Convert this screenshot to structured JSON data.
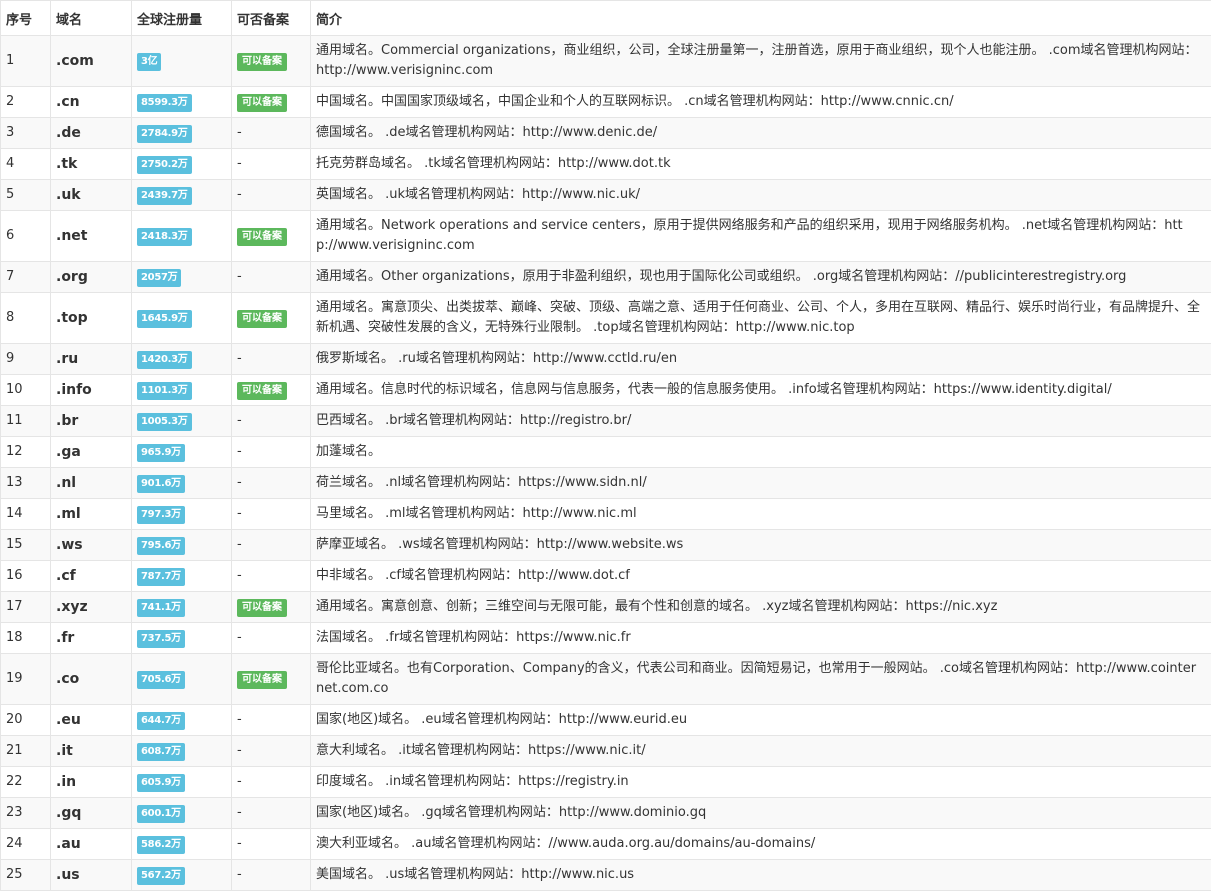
{
  "headers": {
    "idx": "序号",
    "domain": "域名",
    "reg": "全球注册量",
    "icp": "可否备案",
    "desc": "简介"
  },
  "rows": [
    {
      "idx": "1",
      "domain": ".com",
      "reg": "3亿",
      "icp": "可以备案",
      "desc": "通用域名。Commercial organizations，商业组织，公司，全球注册量第一，注册首选，原用于商业组织，现个人也能注册。 .com域名管理机构网站：http://www.verisigninc.com"
    },
    {
      "idx": "2",
      "domain": ".cn",
      "reg": "8599.3万",
      "icp": "可以备案",
      "desc": "中国域名。中国国家顶级域名，中国企业和个人的互联网标识。 .cn域名管理机构网站：http://www.cnnic.cn/"
    },
    {
      "idx": "3",
      "domain": ".de",
      "reg": "2784.9万",
      "icp": "-",
      "desc": "德国域名。 .de域名管理机构网站：http://www.denic.de/"
    },
    {
      "idx": "4",
      "domain": ".tk",
      "reg": "2750.2万",
      "icp": "-",
      "desc": "托克劳群岛域名。 .tk域名管理机构网站：http://www.dot.tk"
    },
    {
      "idx": "5",
      "domain": ".uk",
      "reg": "2439.7万",
      "icp": "-",
      "desc": "英国域名。 .uk域名管理机构网站：http://www.nic.uk/"
    },
    {
      "idx": "6",
      "domain": ".net",
      "reg": "2418.3万",
      "icp": "可以备案",
      "desc": "通用域名。Network operations and service centers，原用于提供网络服务和产品的组织采用，现用于网络服务机构。 .net域名管理机构网站：http://www.verisigninc.com"
    },
    {
      "idx": "7",
      "domain": ".org",
      "reg": "2057万",
      "icp": "-",
      "desc": "通用域名。Other organizations，原用于非盈利组织，现也用于国际化公司或组织。 .org域名管理机构网站：//publicinterestregistry.org"
    },
    {
      "idx": "8",
      "domain": ".top",
      "reg": "1645.9万",
      "icp": "可以备案",
      "desc": "通用域名。寓意顶尖、出类拔萃、巅峰、突破、顶级、高端之意、适用于任何商业、公司、个人，多用在互联网、精品行、娱乐时尚行业，有品牌提升、全新机遇、突破性发展的含义，无特殊行业限制。 .top域名管理机构网站：http://www.nic.top"
    },
    {
      "idx": "9",
      "domain": ".ru",
      "reg": "1420.3万",
      "icp": "-",
      "desc": "俄罗斯域名。 .ru域名管理机构网站：http://www.cctld.ru/en"
    },
    {
      "idx": "10",
      "domain": ".info",
      "reg": "1101.3万",
      "icp": "可以备案",
      "desc": "通用域名。信息时代的标识域名，信息网与信息服务，代表一般的信息服务使用。 .info域名管理机构网站：https://www.identity.digital/"
    },
    {
      "idx": "11",
      "domain": ".br",
      "reg": "1005.3万",
      "icp": "-",
      "desc": "巴西域名。 .br域名管理机构网站：http://registro.br/"
    },
    {
      "idx": "12",
      "domain": ".ga",
      "reg": "965.9万",
      "icp": "-",
      "desc": "加蓬域名。"
    },
    {
      "idx": "13",
      "domain": ".nl",
      "reg": "901.6万",
      "icp": "-",
      "desc": "荷兰域名。 .nl域名管理机构网站：https://www.sidn.nl/"
    },
    {
      "idx": "14",
      "domain": ".ml",
      "reg": "797.3万",
      "icp": "-",
      "desc": "马里域名。 .ml域名管理机构网站：http://www.nic.ml"
    },
    {
      "idx": "15",
      "domain": ".ws",
      "reg": "795.6万",
      "icp": "-",
      "desc": "萨摩亚域名。 .ws域名管理机构网站：http://www.website.ws"
    },
    {
      "idx": "16",
      "domain": ".cf",
      "reg": "787.7万",
      "icp": "-",
      "desc": "中非域名。 .cf域名管理机构网站：http://www.dot.cf"
    },
    {
      "idx": "17",
      "domain": ".xyz",
      "reg": "741.1万",
      "icp": "可以备案",
      "desc": "通用域名。寓意创意、创新；三维空间与无限可能，最有个性和创意的域名。 .xyz域名管理机构网站：https://nic.xyz"
    },
    {
      "idx": "18",
      "domain": ".fr",
      "reg": "737.5万",
      "icp": "-",
      "desc": "法国域名。 .fr域名管理机构网站：https://www.nic.fr"
    },
    {
      "idx": "19",
      "domain": ".co",
      "reg": "705.6万",
      "icp": "可以备案",
      "desc": "哥伦比亚域名。也有Corporation、Company的含义，代表公司和商业。因简短易记，也常用于一般网站。 .co域名管理机构网站：http://www.cointernet.com.co"
    },
    {
      "idx": "20",
      "domain": ".eu",
      "reg": "644.7万",
      "icp": "-",
      "desc": "国家(地区)域名。 .eu域名管理机构网站：http://www.eurid.eu"
    },
    {
      "idx": "21",
      "domain": ".it",
      "reg": "608.7万",
      "icp": "-",
      "desc": "意大利域名。 .it域名管理机构网站：https://www.nic.it/"
    },
    {
      "idx": "22",
      "domain": ".in",
      "reg": "605.9万",
      "icp": "-",
      "desc": "印度域名。 .in域名管理机构网站：https://registry.in"
    },
    {
      "idx": "23",
      "domain": ".gq",
      "reg": "600.1万",
      "icp": "-",
      "desc": "国家(地区)域名。 .gq域名管理机构网站：http://www.dominio.gq"
    },
    {
      "idx": "24",
      "domain": ".au",
      "reg": "586.2万",
      "icp": "-",
      "desc": "澳大利亚域名。 .au域名管理机构网站：//www.auda.org.au/domains/au-domains/"
    },
    {
      "idx": "25",
      "domain": ".us",
      "reg": "567.2万",
      "icp": "-",
      "desc": "美国域名。 .us域名管理机构网站：http://www.nic.us"
    }
  ]
}
